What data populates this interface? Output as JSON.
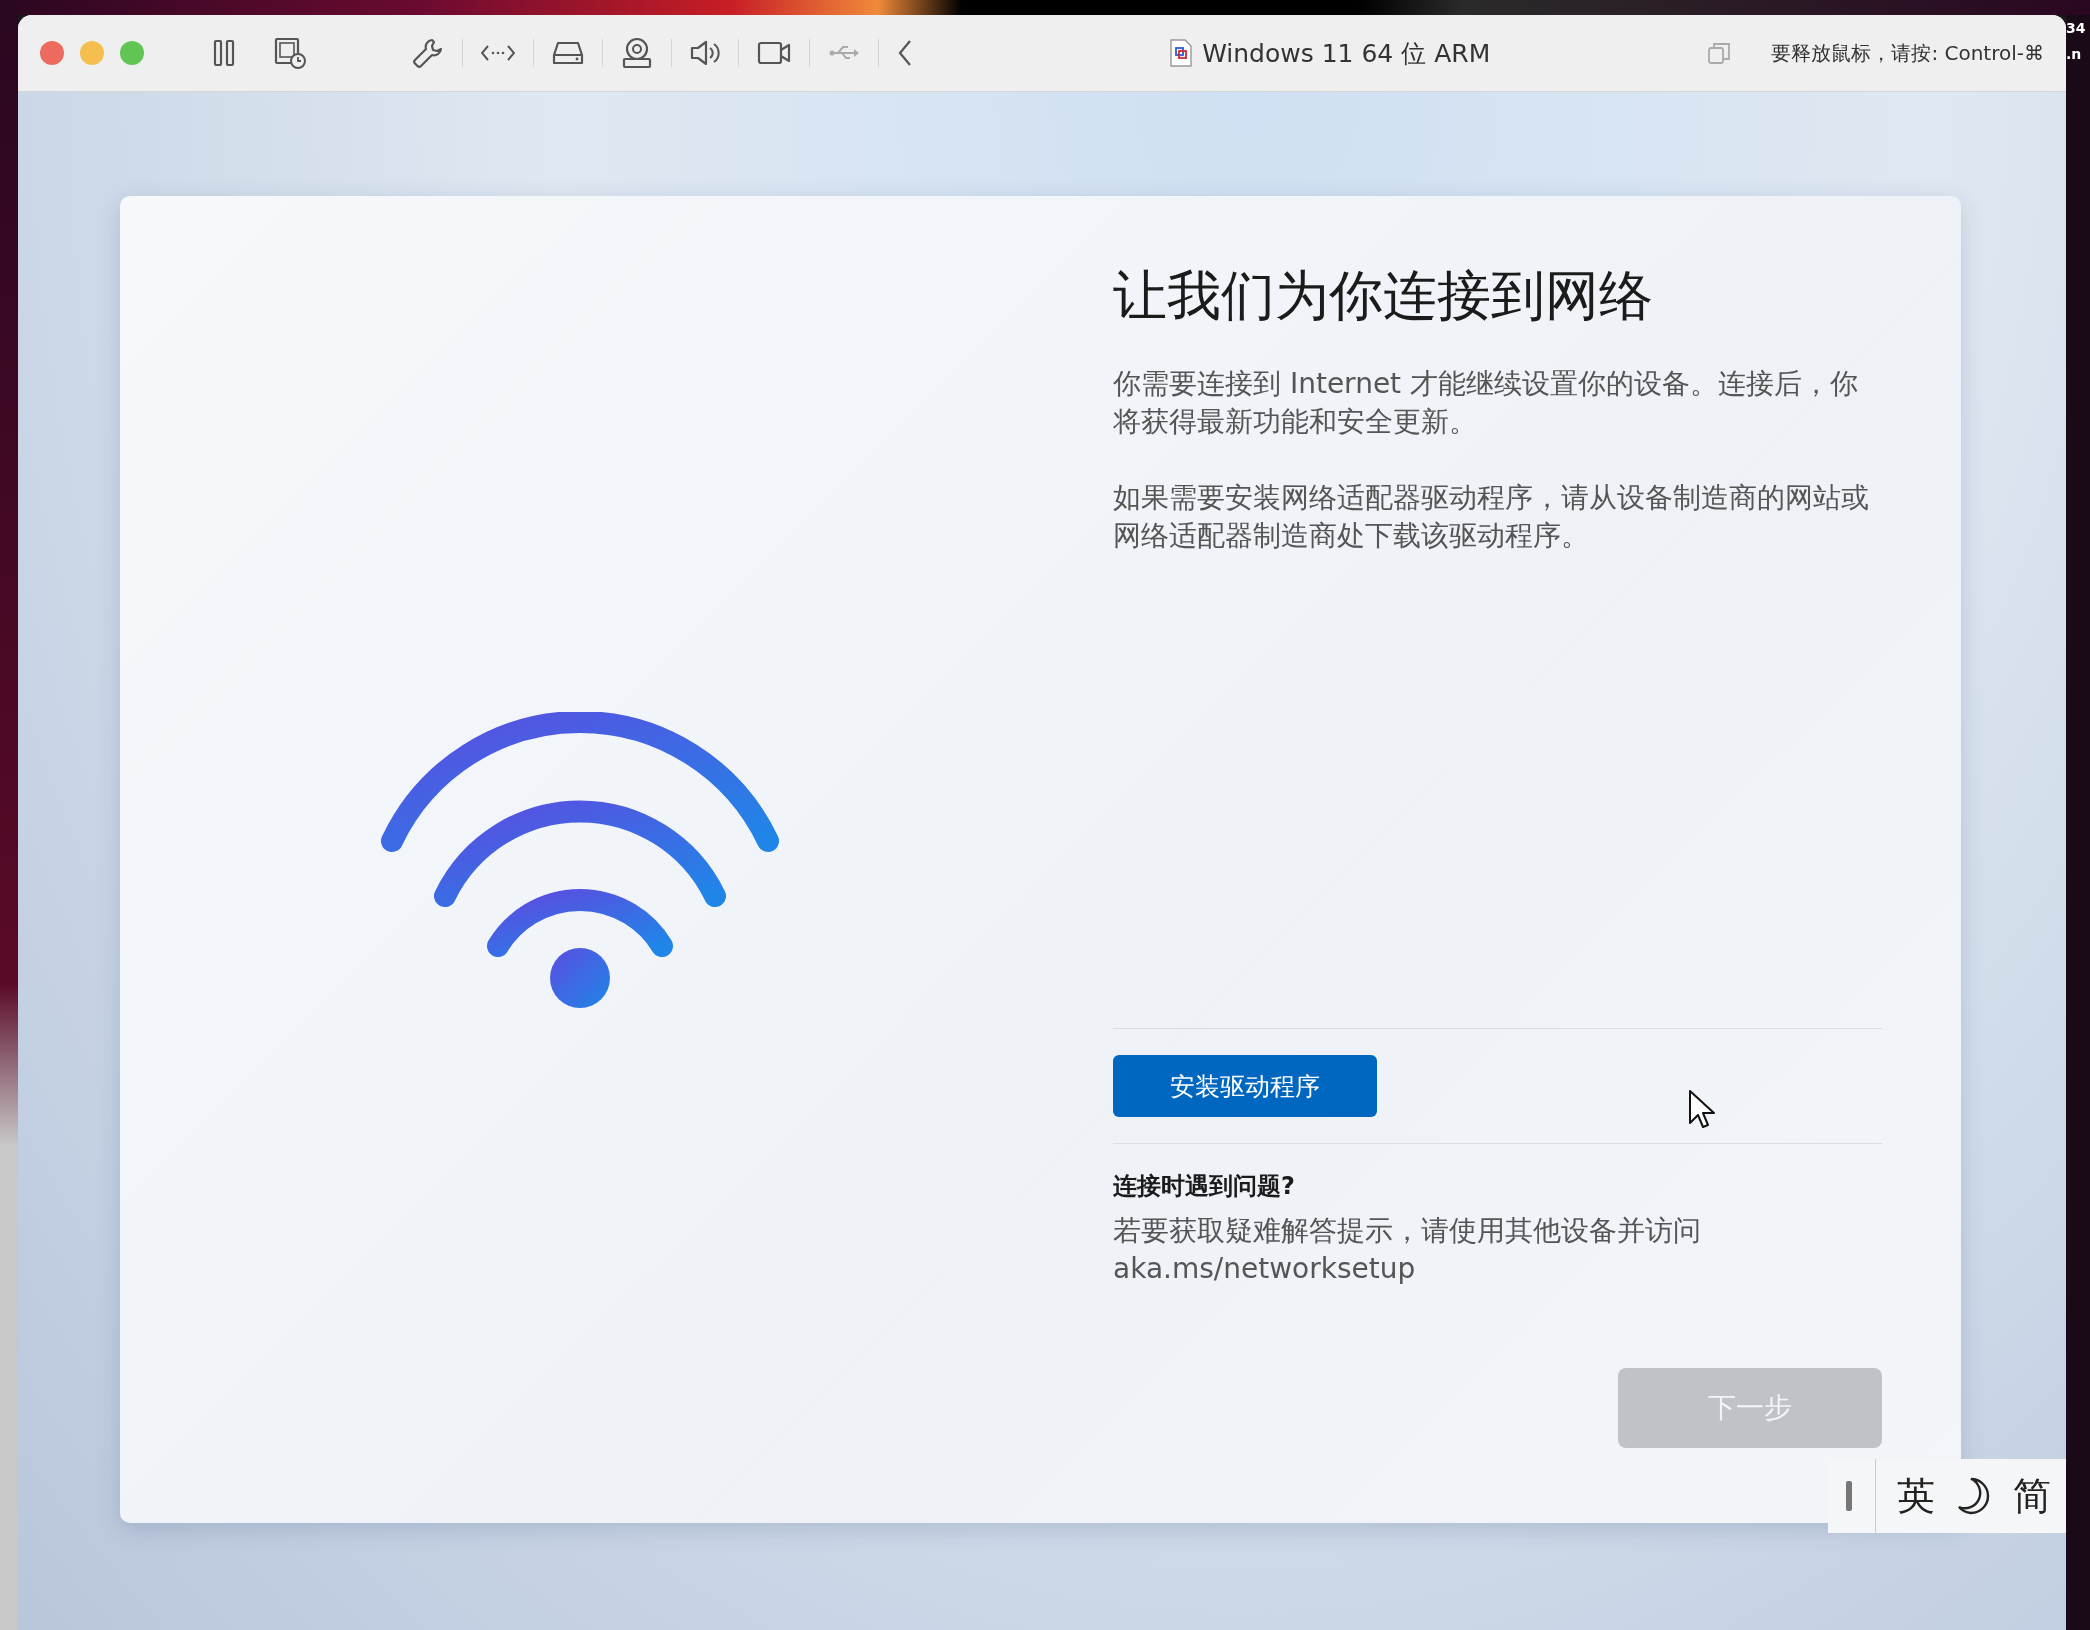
{
  "window": {
    "title": "Windows 11 64 位 ARM",
    "release_hint": "要释放鼠标，请按: Control-⌘"
  },
  "desktop_fragments": [
    "34",
    ".n"
  ],
  "setup": {
    "heading": "让我们为你连接到网络",
    "paragraphs": [
      "你需要连接到 Internet 才能继续设置你的设备。连接后，你将获得最新功能和安全更新。",
      "如果需要安装网络适配器驱动程序，请从设备制造商的网站或网络适配器制造商处下载该驱动程序。"
    ],
    "install_button": "安装驱动程序",
    "help_title": "连接时遇到问题?",
    "help_text": "若要获取疑难解答提示，请使用其他设备并访问 aka.ms/networksetup",
    "next_button": {
      "label": "下一步",
      "disabled": true
    }
  },
  "ime": {
    "mode": "英",
    "script": "简"
  }
}
